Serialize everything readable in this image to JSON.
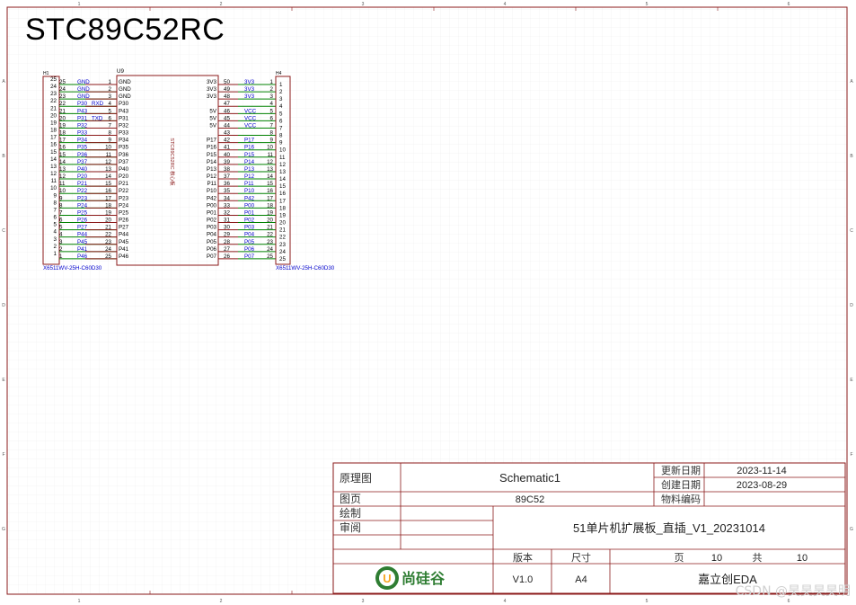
{
  "sheet_title": "STC89C52RC",
  "colors": {
    "part_body": "#8b1a1a",
    "pin_line": "#8b1a1a",
    "wire": "#008000",
    "net_label": "#0000cc",
    "pin_text": "#000000",
    "frame": "#8b1a1a",
    "grid": "#e6e6e6"
  },
  "frame_ruler": {
    "top": [
      "1",
      "2",
      "3",
      "4",
      "5",
      "6"
    ],
    "side": [
      "A",
      "B",
      "C",
      "D",
      "E",
      "F",
      "G"
    ]
  },
  "h1": {
    "designator": "H1",
    "footprint": "X6511WV-25H-C60D30",
    "outer_numbers": [
      "25",
      "24",
      "23",
      "22",
      "21",
      "20",
      "19",
      "18",
      "17",
      "16",
      "15",
      "14",
      "13",
      "12",
      "11",
      "10",
      "9",
      "8",
      "7",
      "6",
      "5",
      "4",
      "3",
      "2",
      "1"
    ],
    "inner_numbers": [
      "25",
      "24",
      "23",
      "22",
      "21",
      "20",
      "19",
      "18",
      "17",
      "16",
      "15",
      "14",
      "13",
      "12",
      "11",
      "10",
      "9",
      "8",
      "7",
      "6",
      "5",
      "4",
      "3",
      "2",
      "1"
    ],
    "net_labels": [
      "GND",
      "GND",
      "GND",
      "P30",
      "P43",
      "P31",
      "P32",
      "P33",
      "P34",
      "P35",
      "P36",
      "P37",
      "P40",
      "P20",
      "P21",
      "P22",
      "P23",
      "P24",
      "P25",
      "P26",
      "P27",
      "P44",
      "P45",
      "P41",
      "P46"
    ],
    "extra_labels": {
      "3": "RXD",
      "5": "TXD"
    }
  },
  "u9": {
    "designator": "U9",
    "body_label": "STC89C52RC 核心板",
    "left_pins": [
      {
        "num": "1",
        "name": "GND"
      },
      {
        "num": "2",
        "name": "GND"
      },
      {
        "num": "3",
        "name": "GND"
      },
      {
        "num": "4",
        "name": "P30"
      },
      {
        "num": "5",
        "name": "P43"
      },
      {
        "num": "6",
        "name": "P31"
      },
      {
        "num": "7",
        "name": "P32"
      },
      {
        "num": "8",
        "name": "P33"
      },
      {
        "num": "9",
        "name": "P34"
      },
      {
        "num": "10",
        "name": "P35"
      },
      {
        "num": "11",
        "name": "P36"
      },
      {
        "num": "12",
        "name": "P37"
      },
      {
        "num": "13",
        "name": "P40"
      },
      {
        "num": "14",
        "name": "P20"
      },
      {
        "num": "15",
        "name": "P21"
      },
      {
        "num": "16",
        "name": "P22"
      },
      {
        "num": "17",
        "name": "P23"
      },
      {
        "num": "18",
        "name": "P24"
      },
      {
        "num": "19",
        "name": "P25"
      },
      {
        "num": "20",
        "name": "P26"
      },
      {
        "num": "21",
        "name": "P27"
      },
      {
        "num": "22",
        "name": "P44"
      },
      {
        "num": "23",
        "name": "P45"
      },
      {
        "num": "24",
        "name": "P41"
      },
      {
        "num": "25",
        "name": "P46"
      }
    ],
    "right_pins": [
      {
        "num": "50",
        "name": "3V3"
      },
      {
        "num": "49",
        "name": "3V3"
      },
      {
        "num": "48",
        "name": "3V3"
      },
      {
        "num": "47",
        "name": ""
      },
      {
        "num": "46",
        "name": "5V"
      },
      {
        "num": "45",
        "name": "5V"
      },
      {
        "num": "44",
        "name": "5V"
      },
      {
        "num": "43",
        "name": ""
      },
      {
        "num": "42",
        "name": "P17"
      },
      {
        "num": "41",
        "name": "P16"
      },
      {
        "num": "40",
        "name": "P15"
      },
      {
        "num": "39",
        "name": "P14"
      },
      {
        "num": "38",
        "name": "P13"
      },
      {
        "num": "37",
        "name": "P12"
      },
      {
        "num": "36",
        "name": "P11"
      },
      {
        "num": "35",
        "name": "P10"
      },
      {
        "num": "34",
        "name": "P42"
      },
      {
        "num": "33",
        "name": "P00"
      },
      {
        "num": "32",
        "name": "P01"
      },
      {
        "num": "31",
        "name": "P02"
      },
      {
        "num": "30",
        "name": "P03"
      },
      {
        "num": "29",
        "name": "P04"
      },
      {
        "num": "28",
        "name": "P05"
      },
      {
        "num": "27",
        "name": "P06"
      },
      {
        "num": "26",
        "name": "P07"
      }
    ],
    "right_net_labels": [
      "3V3",
      "3V3",
      "3V3",
      "",
      "VCC",
      "VCC",
      "VCC",
      "",
      "P17",
      "P16",
      "P15",
      "P14",
      "P13",
      "P12",
      "P11",
      "P10",
      "P42",
      "P00",
      "P01",
      "P02",
      "P03",
      "P04",
      "P05",
      "P06",
      "P07"
    ]
  },
  "h4": {
    "designator": "H4",
    "footprint": "X6511WV-25H-C60D30",
    "inner_numbers": [
      "1",
      "2",
      "3",
      "4",
      "5",
      "6",
      "7",
      "8",
      "9",
      "10",
      "11",
      "12",
      "13",
      "14",
      "15",
      "16",
      "17",
      "18",
      "19",
      "20",
      "21",
      "22",
      "23",
      "24",
      "25"
    ],
    "outer_numbers": [
      "1",
      "2",
      "3",
      "4",
      "5",
      "6",
      "7",
      "8",
      "9",
      "10",
      "11",
      "12",
      "13",
      "14",
      "15",
      "16",
      "17",
      "18",
      "19",
      "20",
      "21",
      "22",
      "23",
      "24",
      "25"
    ]
  },
  "title_block": {
    "schematic_label": "原理图",
    "schematic_value": "Schematic1",
    "page_label": "图页",
    "page_value": "89C52",
    "drawn_label": "绘制",
    "review_label": "审阅",
    "project_value": "51单片机扩展板_直插_V1_20231014",
    "updated_label": "更新日期",
    "updated_value": "2023-11-14",
    "created_label": "创建日期",
    "created_value": "2023-08-29",
    "part_label": "物料编码",
    "version_label": "版本",
    "size_label": "尺寸",
    "page_num_label": "页",
    "page_num_value": "10",
    "total_label": "共",
    "total_value": "10",
    "version_value": "V1.0",
    "size_value": "A4",
    "company": "嘉立创EDA",
    "logo_text": "尚硅谷",
    "logo_letter": "U"
  },
  "watermark": "CSDN @昊昊昊昊明"
}
